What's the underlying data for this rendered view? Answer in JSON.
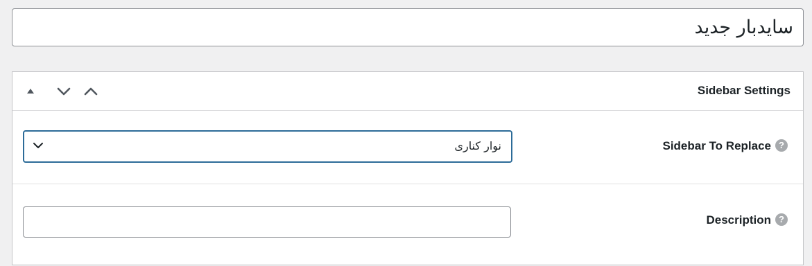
{
  "title_field": {
    "value": "سایدبار جدید"
  },
  "postbox": {
    "title": "Sidebar Settings",
    "controls": [
      "triangle-up-icon",
      "chevron-down-icon",
      "chevron-up-icon"
    ]
  },
  "fields": {
    "sidebar_to_replace": {
      "label": "Sidebar To Replace",
      "help": "?",
      "selected": "نوار کناری"
    },
    "description": {
      "label": "Description",
      "help": "?",
      "value": ""
    }
  },
  "colors": {
    "page_background": "#f0f0f1",
    "panel_background": "#ffffff",
    "focus_border": "#2c6b98",
    "help_icon": "#a7aaad"
  }
}
